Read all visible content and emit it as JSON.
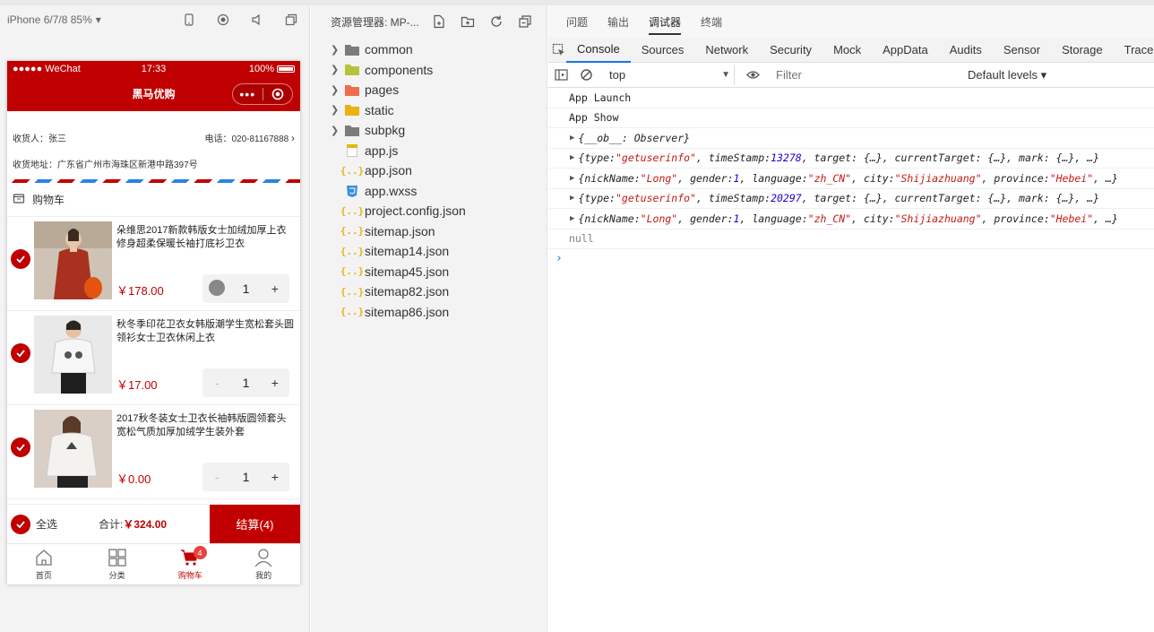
{
  "simulator": {
    "device": "iPhone 6/7/8 85%",
    "status": {
      "carrier": "●●●●● WeChat",
      "time": "17:33",
      "battery": "100%"
    },
    "nav_title": "黑马优购",
    "capsule_dots": "•••",
    "address": {
      "receiver": "收货人：张三",
      "phone": "电话：020-81167888",
      "location": "收货地址：广东省广州市海珠区新港中路397号"
    },
    "cart_title": "购物车",
    "goods": [
      {
        "name": "朵维思2017新款韩版女士加绒加厚上衣修身超柔保暖长袖打底衫卫衣",
        "price": "￥178.00",
        "qty": "1",
        "minus": "-",
        "plus": "+"
      },
      {
        "name": "秋冬季印花卫衣女韩版潮学生宽松套头圆领衫女士卫衣休闲上衣",
        "price": "￥17.00",
        "qty": "1",
        "minus": "-",
        "plus": "+"
      },
      {
        "name": "2017秋冬装女士卫衣长袖韩版圆领套头宽松气质加厚加绒学生装外套",
        "price": "￥0.00",
        "qty": "1",
        "minus": "-",
        "plus": "+"
      }
    ],
    "settle": {
      "select_all": "全选",
      "total_label": "合计:",
      "total_value": "￥324.00",
      "button": "结算(4)"
    },
    "tabbar": [
      {
        "label": "首页"
      },
      {
        "label": "分类"
      },
      {
        "label": "购物车",
        "badge": "4"
      },
      {
        "label": "我的"
      }
    ]
  },
  "explorer": {
    "title": "资源管理器: MP-...",
    "folders": [
      "common",
      "components",
      "pages",
      "static",
      "subpkg"
    ],
    "files": [
      {
        "name": "app.js",
        "type": "js"
      },
      {
        "name": "app.json",
        "type": "json"
      },
      {
        "name": "app.wxss",
        "type": "css"
      },
      {
        "name": "project.config.json",
        "type": "json"
      },
      {
        "name": "sitemap.json",
        "type": "json"
      },
      {
        "name": "sitemap14.json",
        "type": "json"
      },
      {
        "name": "sitemap45.json",
        "type": "json"
      },
      {
        "name": "sitemap82.json",
        "type": "json"
      },
      {
        "name": "sitemap86.json",
        "type": "json"
      }
    ],
    "json_icon": "{..}"
  },
  "devtools": {
    "panel_tabs": [
      "问题",
      "输出",
      "调试器",
      "终端"
    ],
    "tabs": [
      "Console",
      "Sources",
      "Network",
      "Security",
      "Mock",
      "AppData",
      "Audits",
      "Sensor",
      "Storage",
      "Trace"
    ],
    "context": "top",
    "filter_placeholder": "Filter",
    "levels": "Default levels ▾",
    "logs": {
      "launch": "App Launch",
      "show": "App Show",
      "observer": "{__ob__: Observer}",
      "evt1": {
        "type": "\"getuserinfo\"",
        "ts": "13278"
      },
      "user1": {
        "nick": "\"Long\"",
        "gender": "1",
        "lang": "\"zh_CN\"",
        "city": "\"Shijiazhuang\"",
        "prov": "\"Hebei\""
      },
      "evt2": {
        "type": "\"getuserinfo\"",
        "ts": "20297"
      },
      "user2": {
        "nick": "\"Long\"",
        "gender": "1",
        "lang": "\"zh_CN\"",
        "city": "\"Shijiazhuang\"",
        "prov": "\"Hebei\""
      },
      "null": "null"
    },
    "prompt": "›"
  },
  "colors": {
    "brand": "#c00000",
    "link": "#1a73e8"
  }
}
